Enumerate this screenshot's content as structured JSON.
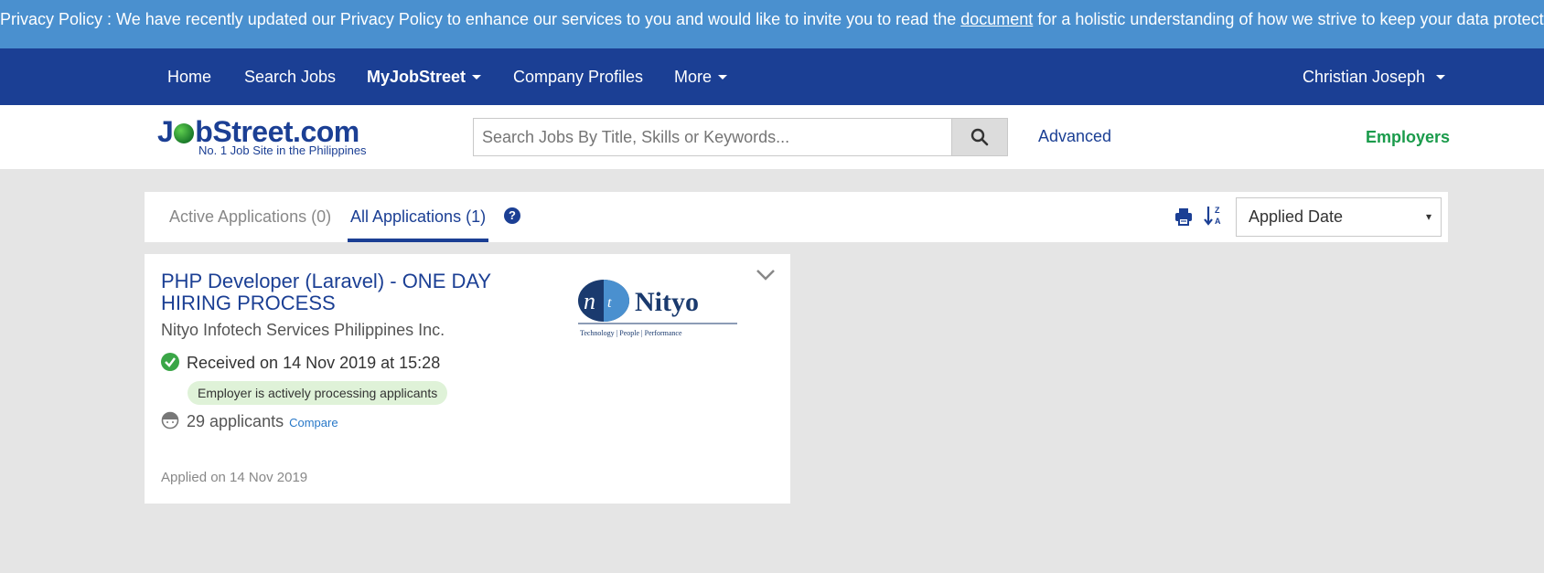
{
  "privacy": {
    "text_before": "Privacy Policy : We have recently updated our Privacy Policy to enhance our services to you and would like to invite you to read the",
    "link": "document",
    "text_after": "for a holistic understanding of how we strive to keep your data protected."
  },
  "topnav": {
    "home": "Home",
    "search_jobs": "Search Jobs",
    "myjobstreet": "MyJobStreet",
    "company_profiles": "Company Profiles",
    "more": "More",
    "user": "Christian Joseph"
  },
  "header": {
    "logo_text_a": "J",
    "logo_text_b": "bStreet.com",
    "logo_tagline": "No. 1 Job Site in the Philippines",
    "search_placeholder": "Search Jobs By Title, Skills or Keywords...",
    "advanced": "Advanced",
    "employers": "Employers"
  },
  "tabs": {
    "active_apps": "Active Applications (0)",
    "all_apps": "All Applications (1)",
    "help": "?",
    "sort_label": "Applied Date",
    "sort_arrow": "▾"
  },
  "job": {
    "title": "PHP Developer (Laravel) - ONE DAY HIRING PROCESS",
    "company": "Nityo Infotech Services Philippines Inc.",
    "logo_text": "Nityo",
    "logo_sub": "Technology  |  People  |  Performance",
    "received": "Received on 14 Nov 2019 at 15:28",
    "badge": "Employer is actively processing applicants",
    "applicants": "29 applicants",
    "compare": "Compare",
    "applied_on": "Applied on 14 Nov 2019"
  },
  "colors": {
    "privacy_bar": "#4a90cf",
    "nav_bar": "#1b3f94",
    "employers_green": "#1a9b4b",
    "badge_bg": "#dff2d8"
  }
}
